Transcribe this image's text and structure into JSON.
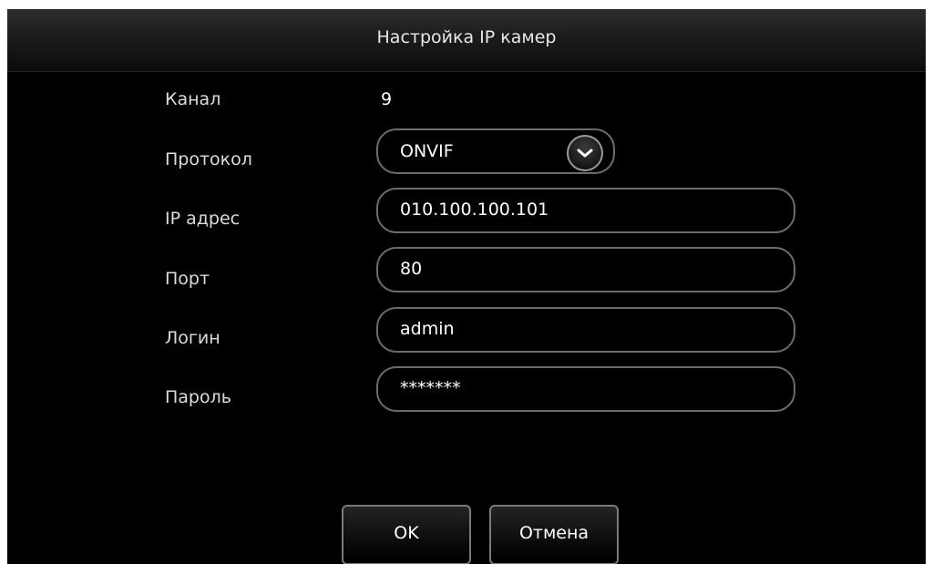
{
  "dialog": {
    "title": "Настройка IP камер"
  },
  "form": {
    "channel": {
      "label": "Канал",
      "value": "9"
    },
    "protocol": {
      "label": "Протокол",
      "value": "ONVIF",
      "icon": "chevron-down-icon"
    },
    "ip": {
      "label": "IP адрес",
      "value": "010.100.100.101"
    },
    "port": {
      "label": "Порт",
      "value": "80"
    },
    "login": {
      "label": "Логин",
      "value": "admin"
    },
    "password": {
      "label": "Пароль",
      "value": "*******"
    }
  },
  "buttons": {
    "ok_label": "OK",
    "cancel_label": "Отмена"
  },
  "colors": {
    "background": "#000000",
    "field_border": "#6c6c6c",
    "text": "#ffffff"
  }
}
